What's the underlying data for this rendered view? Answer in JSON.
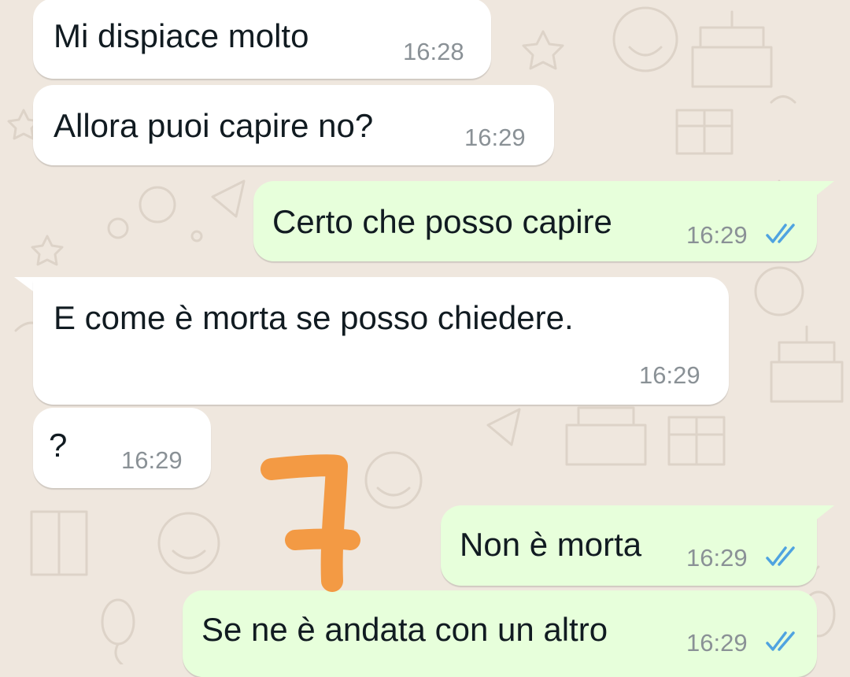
{
  "colors": {
    "background": "#efe7de",
    "incoming_bubble": "#ffffff",
    "outgoing_bubble": "#e7ffdb",
    "timestamp": "#8a9196",
    "read_ticks": "#4fa3e0",
    "annotation_stroke": "#f39a44"
  },
  "messages": [
    {
      "text": "Mi dispiace molto",
      "time": "16:28",
      "direction": "in"
    },
    {
      "text": "Allora puoi capire no?",
      "time": "16:29",
      "direction": "in"
    },
    {
      "text": "Certo che posso capire",
      "time": "16:29",
      "direction": "out",
      "status": "read-double-check-icon"
    },
    {
      "text": "E come è morta se posso chiedere.",
      "time": "16:29",
      "direction": "in"
    },
    {
      "text": "?",
      "time": "16:29",
      "direction": "in"
    },
    {
      "text": "Non è morta",
      "time": "16:29",
      "direction": "out",
      "status": "read-double-check-icon"
    },
    {
      "text": "Se ne è andata con un altro",
      "time": "16:29",
      "direction": "out",
      "status": "read-double-check-icon"
    }
  ],
  "annotation": {
    "icon": "hand-drawn-seven-mark",
    "color": "#f39a44"
  }
}
